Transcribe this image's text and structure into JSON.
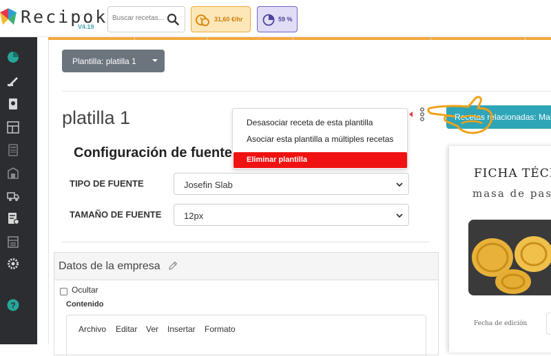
{
  "app": {
    "name": "Recipok",
    "version": "V4.19"
  },
  "header": {
    "search": {
      "placeholder": "Buscar recetas..."
    },
    "labor_rate": "31,60 €/hr",
    "percentage": "59 %"
  },
  "sidebar": {
    "items": [
      {
        "icon": "pie-chart-icon"
      },
      {
        "icon": "brush-icon"
      },
      {
        "icon": "recipe-book-icon"
      },
      {
        "icon": "layout-icon"
      },
      {
        "icon": "calculator-icon"
      },
      {
        "icon": "warehouse-icon"
      },
      {
        "icon": "truck-icon"
      },
      {
        "icon": "invoice-icon"
      },
      {
        "icon": "store-icon"
      },
      {
        "icon": "settings-icon"
      },
      {
        "icon": "help-icon"
      }
    ]
  },
  "template": {
    "dropdown_label": "Plantilla: platilla 1",
    "name": "platilla 1"
  },
  "font_config": {
    "title": "Configuración de fuente",
    "type_label": "TIPO DE FUENTE",
    "type_value": "Josefin Slab",
    "size_label": "TAMAÑO DE FUENTE",
    "size_value": "12px"
  },
  "context_menu": {
    "items": [
      "Desasociar receta de esta plantilla",
      "Asociar esta plantilla a múltiples recetas"
    ],
    "danger_item": "Eliminar plantilla"
  },
  "related_button": "Recetas relacionadas: Mas",
  "company": {
    "title": "Datos de la empresa",
    "hide_label": "Ocultar",
    "content_label": "Contenido",
    "editor_menu": [
      "Archivo",
      "Editar",
      "Ver",
      "Insertar",
      "Formato"
    ]
  },
  "preview": {
    "heading": "FICHA TÉCN",
    "subheading": "masa de past",
    "date_label": "Fecha de edición"
  },
  "colors": {
    "sidebar_bg": "#2b2d30",
    "accent_teal": "#2fa5b8",
    "accent_orange": "#f4a83a",
    "danger": "#f01212",
    "template_button": "#6c757d"
  }
}
